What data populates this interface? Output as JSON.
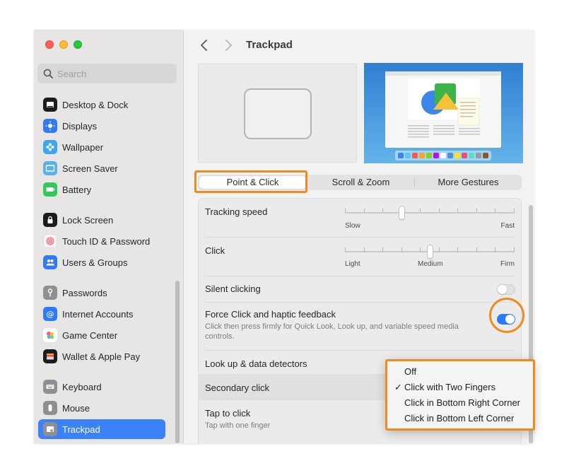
{
  "search": {
    "placeholder": "Search"
  },
  "sidebar": {
    "items": [
      {
        "label": "Desktop & Dock",
        "icon": "dock-icon",
        "color": "#1c1c1e"
      },
      {
        "label": "Displays",
        "icon": "sun-icon",
        "color": "#2f7bf5"
      },
      {
        "label": "Wallpaper",
        "icon": "flower-icon",
        "color": "#39a8f0"
      },
      {
        "label": "Screen Saver",
        "icon": "screen-icon",
        "color": "#5ab1e8"
      },
      {
        "label": "Battery",
        "icon": "battery-icon",
        "color": "#34c759"
      },
      {
        "label": "Lock Screen",
        "icon": "lock-icon",
        "color": "#1c1c1e"
      },
      {
        "label": "Touch ID & Password",
        "icon": "fingerprint-icon",
        "color": "#f4f4f4"
      },
      {
        "label": "Users & Groups",
        "icon": "users-icon",
        "color": "#2f7bf5"
      },
      {
        "label": "Passwords",
        "icon": "key-icon",
        "color": "#8e8e93"
      },
      {
        "label": "Internet Accounts",
        "icon": "at-icon",
        "color": "#2f7bf5"
      },
      {
        "label": "Game Center",
        "icon": "game-center-icon",
        "color": "#ffffff"
      },
      {
        "label": "Wallet & Apple Pay",
        "icon": "wallet-icon",
        "color": "#1c1c1e"
      },
      {
        "label": "Keyboard",
        "icon": "keyboard-icon",
        "color": "#8e8e93"
      },
      {
        "label": "Mouse",
        "icon": "mouse-icon",
        "color": "#8e8e93"
      },
      {
        "label": "Trackpad",
        "icon": "trackpad-icon",
        "color": "#8e8e93"
      }
    ]
  },
  "header": {
    "title": "Trackpad"
  },
  "tabs": [
    {
      "label": "Point & Click"
    },
    {
      "label": "Scroll & Zoom"
    },
    {
      "label": "More Gestures"
    }
  ],
  "settings": {
    "tracking_speed": {
      "label": "Tracking speed",
      "min_label": "Slow",
      "max_label": "Fast",
      "value": 0.33
    },
    "click": {
      "label": "Click",
      "min_label": "Light",
      "mid_label": "Medium",
      "max_label": "Firm",
      "value": 0.5
    },
    "silent_clicking": {
      "label": "Silent clicking",
      "enabled": false
    },
    "force_click": {
      "label": "Force Click and haptic feedback",
      "description": "Click then press firmly for Quick Look, Look up, and variable speed media controls.",
      "enabled": true
    },
    "look_up": {
      "label": "Look up & data detectors"
    },
    "secondary_click": {
      "label": "Secondary click"
    },
    "tap_to_click": {
      "label": "Tap to click",
      "description": "Tap with one finger"
    }
  },
  "menu": {
    "options": [
      {
        "label": "Off",
        "checked": false
      },
      {
        "label": "Click with Two Fingers",
        "checked": true
      },
      {
        "label": "Click in Bottom Right Corner",
        "checked": false
      },
      {
        "label": "Click in Bottom Left Corner",
        "checked": false
      }
    ]
  },
  "colors": {
    "accent": "#2f7bf5",
    "highlight": "#f08a1e",
    "sidebar_active": "#3b82f6"
  }
}
